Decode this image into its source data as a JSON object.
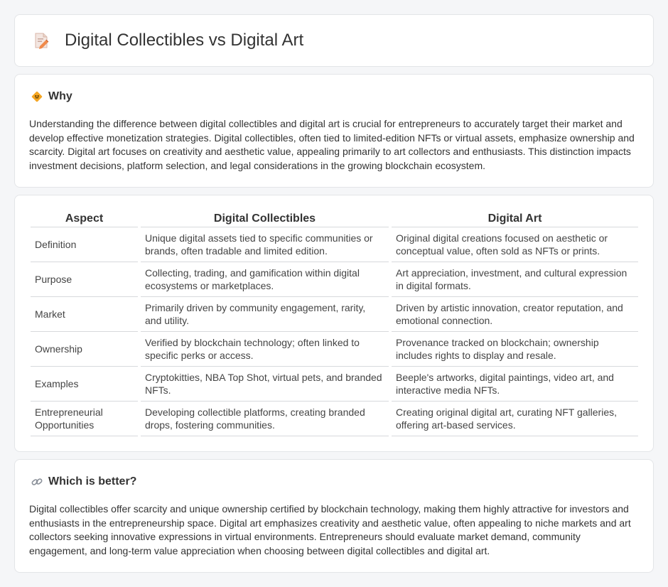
{
  "header": {
    "title": "Digital Collectibles vs Digital Art",
    "icon": "document-pencil-icon"
  },
  "why": {
    "title": "Why",
    "icon": "sign-icon",
    "text": "Understanding the difference between digital collectibles and digital art is crucial for entrepreneurs to accurately target their market and develop effective monetization strategies. Digital collectibles, often tied to limited-edition NFTs or virtual assets, emphasize ownership and scarcity. Digital art focuses on creativity and aesthetic value, appealing primarily to art collectors and enthusiasts. This distinction impacts investment decisions, platform selection, and legal considerations in the growing blockchain ecosystem."
  },
  "table": {
    "headers": [
      "Aspect",
      "Digital Collectibles",
      "Digital Art"
    ],
    "rows": [
      [
        "Definition",
        "Unique digital assets tied to specific communities or brands, often tradable and limited edition.",
        "Original digital creations focused on aesthetic or conceptual value, often sold as NFTs or prints."
      ],
      [
        "Purpose",
        "Collecting, trading, and gamification within digital ecosystems or marketplaces.",
        "Art appreciation, investment, and cultural expression in digital formats."
      ],
      [
        "Market",
        "Primarily driven by community engagement, rarity, and utility.",
        "Driven by artistic innovation, creator reputation, and emotional connection."
      ],
      [
        "Ownership",
        "Verified by blockchain technology; often linked to specific perks or access.",
        "Provenance tracked on blockchain; ownership includes rights to display and resale."
      ],
      [
        "Examples",
        "Cryptokitties, NBA Top Shot, virtual pets, and branded NFTs.",
        "Beeple's artworks, digital paintings, video art, and interactive media NFTs."
      ],
      [
        "Entrepreneurial Opportunities",
        "Developing collectible platforms, creating branded drops, fostering communities.",
        "Creating original digital art, curating NFT galleries, offering art-based services."
      ]
    ]
  },
  "better": {
    "title": "Which is better?",
    "icon": "link-icon",
    "text": "Digital collectibles offer scarcity and unique ownership certified by blockchain technology, making them highly attractive for investors and enthusiasts in the entrepreneurship space. Digital art emphasizes creativity and aesthetic value, often appealing to niche markets and art collectors seeking innovative expressions in virtual environments. Entrepreneurs should evaluate market demand, community engagement, and long-term value appreciation when choosing between digital collectibles and digital art."
  }
}
